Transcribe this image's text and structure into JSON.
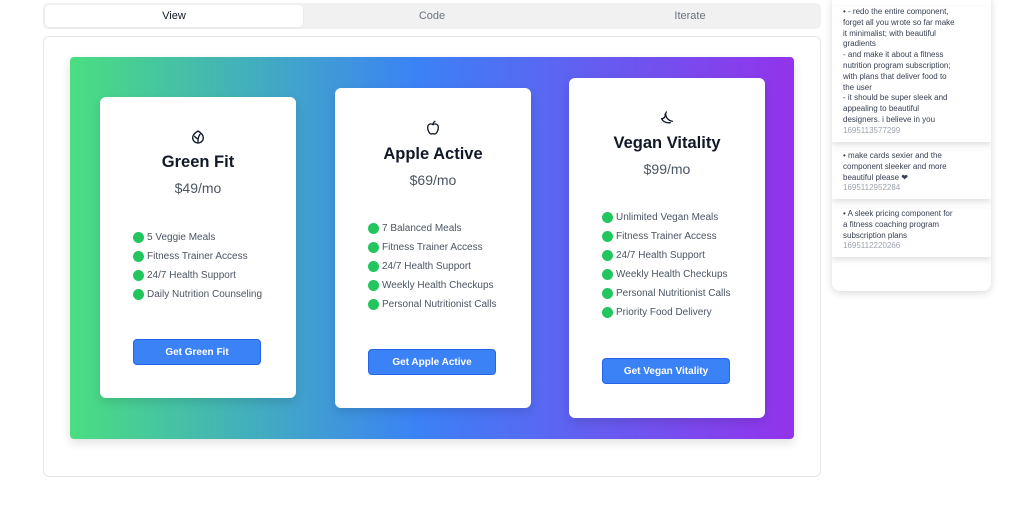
{
  "tabs": [
    {
      "label": "View"
    },
    {
      "label": "Code"
    },
    {
      "label": "Iterate"
    }
  ],
  "plans": [
    {
      "icon": "leaf-icon",
      "name": "Green Fit",
      "price": "$49/mo",
      "features": [
        "5 Veggie Meals",
        "Fitness Trainer Access",
        "24/7 Health Support",
        "Daily Nutrition Counseling"
      ],
      "cta": "Get Green Fit"
    },
    {
      "icon": "apple-icon",
      "name": "Apple Active",
      "price": "$69/mo",
      "features": [
        "7 Balanced Meals",
        "Fitness Trainer Access",
        "24/7 Health Support",
        "Weekly Health Checkups",
        "Personal Nutritionist Calls"
      ],
      "cta": "Get Apple Active"
    },
    {
      "icon": "banana-icon",
      "name": "Vegan Vitality",
      "price": "$99/mo",
      "features": [
        "Unlimited Vegan Meals",
        "Fitness Trainer Access",
        "24/7 Health Support",
        "Weekly Health Checkups",
        "Personal Nutritionist Calls",
        "Priority Food Delivery"
      ],
      "cta": "Get Vegan Vitality"
    }
  ],
  "history": [
    {
      "lines": [
        "• - redo the entire component,",
        "forget all you wrote so far make",
        "it minimalist; with beautiful",
        "gradients",
        "- and make it about a fitness",
        "nutrition program subscription;",
        "with plans that deliver food to",
        "the user",
        "- it should be super sleek and",
        "appealing to beautiful",
        "designers. i believe in you"
      ],
      "timestamp": "1695113577299"
    },
    {
      "lines": [
        "• make cards sexier and the",
        "component sleeker and more",
        "beautiful please ❤"
      ],
      "timestamp": "1695112952284"
    },
    {
      "lines": [
        "• A sleek pricing component for",
        "a fitness coaching program",
        "subscription plans"
      ],
      "timestamp": "1695112220266"
    }
  ],
  "colors": {
    "gradient_start": "#4ade80",
    "gradient_mid": "#3b82f6",
    "gradient_end": "#9333ea",
    "button": "#3b82f6",
    "check_dot": "#22c55e"
  }
}
